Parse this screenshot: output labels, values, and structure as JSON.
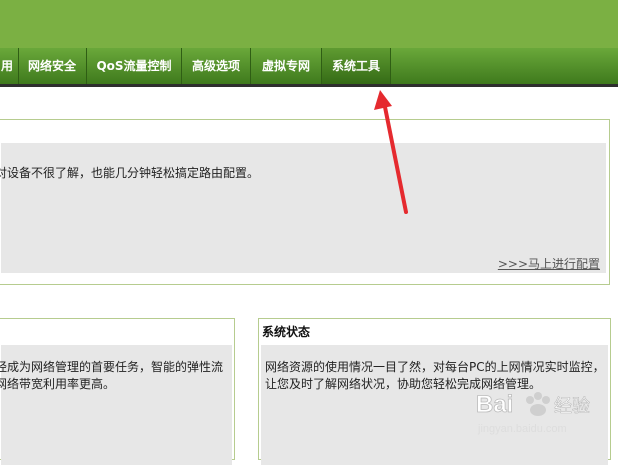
{
  "nav": {
    "items": [
      {
        "label": "用"
      },
      {
        "label": "网络安全"
      },
      {
        "label": "QoS流量控制"
      },
      {
        "label": "高级选项"
      },
      {
        "label": "虚拟专网"
      },
      {
        "label": "系统工具"
      }
    ]
  },
  "panel_quick_setup": {
    "text": "对设备不很了解，也能几分钟轻松搞定路由配置。",
    "link": ">>>马上进行配置"
  },
  "panel_bandwidth": {
    "text": "经成为网络管理的首要任务，智能的弹性流网络带宽利用率更高。"
  },
  "panel_status": {
    "title": "系统状态",
    "text": "网络资源的使用情况一目了然，对每台PC的上网情况实时监控，让您及时了解网络状况，协助您轻松完成网络管理。"
  },
  "watermark": {
    "brand": "Bai",
    "brand2": "经验",
    "sub": "jingyan.baidu.com"
  },
  "colors": {
    "header_green": "#7bb043",
    "arrow_red": "#e52a2f"
  }
}
